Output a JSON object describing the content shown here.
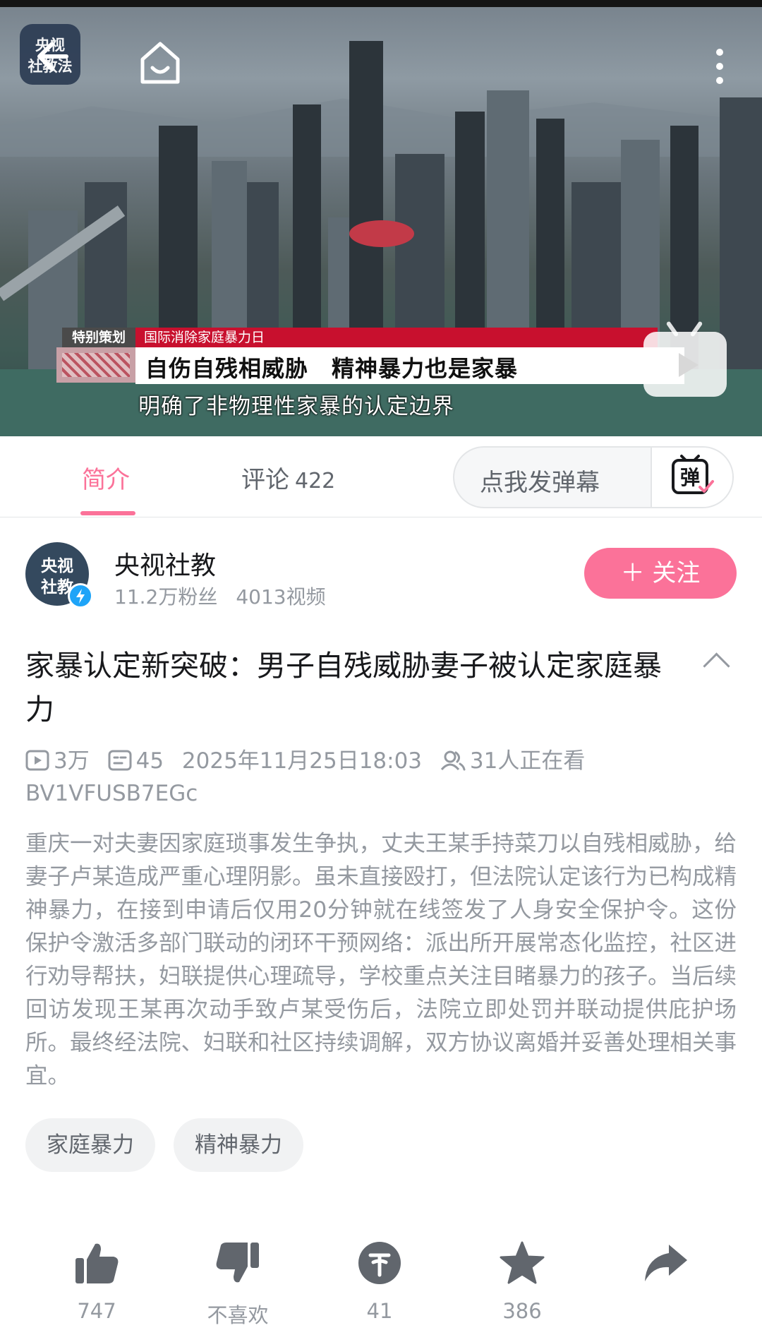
{
  "player": {
    "logo_line1": "央视",
    "logo_line2": "社教法",
    "lower_third_tag": "特别策划",
    "lower_third_topic": "国际消除家庭暴力日",
    "headline": "自伤自残相威胁　精神暴力也是家暴",
    "subtitle": "明确了非物理性家暴的认定边界",
    "icons": {
      "back": "back-arrow-icon",
      "home": "home-icon",
      "more": "more-vertical-icon",
      "tv": "tv-icon"
    }
  },
  "tabs": {
    "intro": "简介",
    "comments": "评论",
    "comments_count": "422",
    "danmu_placeholder": "点我发弹幕",
    "danmu_button_char": "弹"
  },
  "uploader": {
    "avatar_line1": "央视",
    "avatar_line2": "社教",
    "name": "央视社教",
    "fans": "11.2万粉丝",
    "videos": "4013视频",
    "follow_label": "＋ 关注"
  },
  "video": {
    "title": "家暴认定新突破：男子自残威胁妻子被认定家庭暴力",
    "plays": "3万",
    "danmaku": "45",
    "datetime": "2025年11月25日18:03",
    "watching": "31人正在看",
    "bvid": "BV1VFUSB7EGc",
    "description": "重庆一对夫妻因家庭琐事发生争执，丈夫王某手持菜刀以自残相威胁，给妻子卢某造成严重心理阴影。虽未直接殴打，但法院认定该行为已构成精神暴力，在接到申请后仅用20分钟就在线签发了人身安全保护令。这份保护令激活多部门联动的闭环干预网络：派出所开展常态化监控，社区进行劝导帮扶，妇联提供心理疏导，学校重点关注目睹暴力的孩子。当后续回访发现王某再次动手致卢某受伤后，法院立即处罚并联动提供庇护场所。最终经法院、妇联和社区持续调解，双方协议离婚并妥善处理相关事宜。",
    "tags": [
      "家庭暴力",
      "精神暴力"
    ]
  },
  "actions": {
    "like": "747",
    "dislike": "不喜欢",
    "coin": "41",
    "favorite": "386"
  },
  "colors": {
    "accent": "#fb7299",
    "muted": "#9499a0",
    "text": "#18191c"
  }
}
